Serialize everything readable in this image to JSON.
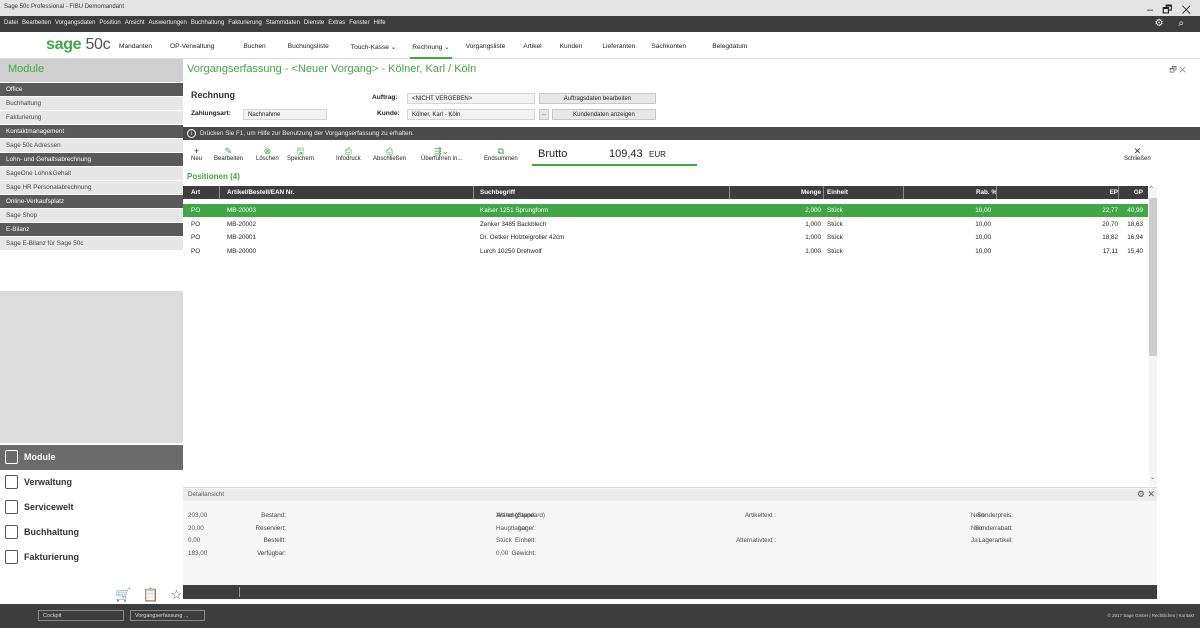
{
  "window": {
    "title": "Sage 50c Professional - FIBU Demomandant",
    "controls": "– 🗗 ✕"
  },
  "menu": {
    "items": [
      "Datei",
      "Bearbeiten",
      "Vorgangsdaten",
      "Position",
      "Ansicht",
      "Auswertungen",
      "Buchhaltung",
      "Fakturierung",
      "Stammdaten",
      "Dienste",
      "Extras",
      "Fenster",
      "Hilfe"
    ],
    "tools": "⚙ ⌕"
  },
  "logo": {
    "brand": "sage",
    "product": "50c"
  },
  "nav": {
    "items": [
      "Mandanten",
      "OP-Verwaltung",
      "Buchen",
      "Buchungsliste",
      "Touch-Kasse ⌄",
      "Rechnung ⌄",
      "Vorgangsliste",
      "Artikel",
      "Kunden",
      "Lieferanten",
      "Sachkonten",
      "Belegdatum"
    ],
    "active": "Rechnung ⌄"
  },
  "sidebar": {
    "title": "Module",
    "groups": [
      {
        "name": "Office",
        "items": [
          "Buchhaltung",
          "Fakturierung"
        ]
      },
      {
        "name": "Kontaktmanagement",
        "items": [
          "Sage 50c Adressen"
        ]
      },
      {
        "name": "Lohn- und Gehaltsabrechnung",
        "items": [
          "SageOne Lohn&Gehalt",
          "Sage HR Personalabrechnung"
        ]
      },
      {
        "name": "Online-Verkaufsplatz",
        "items": [
          "Sage Shop"
        ]
      },
      {
        "name": "E-Bilanz",
        "items": [
          "Sage E-Bilanz für Sage 50c"
        ]
      }
    ],
    "modules": [
      {
        "label": "Module",
        "active": true
      },
      {
        "label": "Verwaltung",
        "active": false
      },
      {
        "label": "Servicewelt",
        "active": false
      },
      {
        "label": "Buchhaltung",
        "active": false
      },
      {
        "label": "Fakturierung",
        "active": false
      }
    ],
    "bottom_icons": "🛒 📋 ☆"
  },
  "doc": {
    "title": "Vorgangserfassung - <Neuer Vorgang> - Kölner, Karl / Köln",
    "controls": "🗗 ✕",
    "type": "Rechnung",
    "zahlungsart_label": "Zahlungsart:",
    "zahlungsart": "Nachnahme",
    "auftrag_label": "Auftrag:",
    "auftrag": "<NICHT VERGEBEN>",
    "auftrag_button": "Auftragsdaten bearbeiten",
    "kunde_label": "Kunde:",
    "kunde": "Kölner, Karl - Köln",
    "kunde_dots": "...",
    "kunde_button": "Kundendaten anzeigen",
    "info": "Drücken Sie F1, um Hilfe zur Benutzung der Vorgangserfassung zu erhalten.",
    "info_icon": "i"
  },
  "toolbar": {
    "buttons": [
      {
        "label": "Neu",
        "glyph": "+"
      },
      {
        "label": "Bearbeiten",
        "glyph": "✎"
      },
      {
        "label": "Löschen",
        "glyph": "⊗"
      },
      {
        "label": "Speichern",
        "glyph": "🖫"
      },
      {
        "label": "Infodruck",
        "glyph": "⎙"
      },
      {
        "label": "Abschließen",
        "glyph": "⎙"
      },
      {
        "label": "Überführen in...",
        "glyph": "⇶⌄"
      },
      {
        "label": "Endsummen",
        "glyph": "⧉"
      }
    ],
    "close_label": "Schließen",
    "close_glyph": "✕"
  },
  "brutto": {
    "label": "Brutto",
    "value": "109,43",
    "currency": "EUR"
  },
  "positions": {
    "title": "Positionen (4)",
    "columns": [
      "Art",
      "Artikel/Bestell/EAN Nr.",
      "Suchbegriff",
      "Menge",
      "Einheit",
      "Rab. %",
      "EP",
      "GP"
    ],
    "rows": [
      {
        "art": "PO",
        "nr": "MB-20003",
        "such": "Kaiser 1251 Sprungform",
        "menge": "2,000",
        "einheit": "Stück",
        "rab": "10,00",
        "ep": "22,77",
        "gp": "40,99",
        "selected": true
      },
      {
        "art": "PO",
        "nr": "MB-20002",
        "such": "Zenker 3485 Backblech",
        "menge": "1,000",
        "einheit": "Stück",
        "rab": "10,00",
        "ep": "20,70",
        "gp": "18,63",
        "selected": false
      },
      {
        "art": "PO",
        "nr": "MB-20001",
        "such": "Dr. Oetker Holzteigroller 42cm",
        "menge": "1,000",
        "einheit": "Stück",
        "rab": "10,00",
        "ep": "18,82",
        "gp": "16,94",
        "selected": false
      },
      {
        "art": "PO",
        "nr": "MB-20000",
        "such": "Lurch 10250 Drehwolf",
        "menge": "1,000",
        "einheit": "Stück",
        "rab": "10,00",
        "ep": "17,11",
        "gp": "15,40",
        "selected": false
      }
    ]
  },
  "detail": {
    "title": "Detailansicht",
    "controls": "⚙ ✕",
    "col1": [
      {
        "l": "Bestand:",
        "v": "203,00"
      },
      {
        "l": "Reserviert:",
        "v": "20,00"
      },
      {
        "l": "Bestellt:",
        "v": "0,00"
      },
      {
        "l": "Verfügbar:",
        "v": "183,00"
      }
    ],
    "col2": [
      {
        "l": "Warengruppe:",
        "v": "Artikel (Standard)"
      },
      {
        "l": "Lager:",
        "v": "Hauptlager"
      },
      {
        "l": "Einheit:",
        "v": "Stück"
      },
      {
        "l": "Gewicht:",
        "v": "0,00"
      }
    ],
    "col3": [
      {
        "l": "Artikeltext :",
        "v": ""
      },
      {
        "l": "",
        "v": ""
      },
      {
        "l": "Alternativtext :",
        "v": ""
      },
      {
        "l": "",
        "v": ""
      }
    ],
    "col4": [
      {
        "l": "Sonderpreis:",
        "v": "Nein"
      },
      {
        "l": "Sonderrabatt:",
        "v": "Nein"
      },
      {
        "l": "Lagerartikel:",
        "v": "Ja"
      },
      {
        "l": "",
        "v": ""
      }
    ]
  },
  "footer": {
    "tabs": [
      "Cockpit",
      "Vorgangserfassung ..."
    ],
    "right": "© 2017 Sage GmbH | Rechtliches | Kontakt"
  }
}
